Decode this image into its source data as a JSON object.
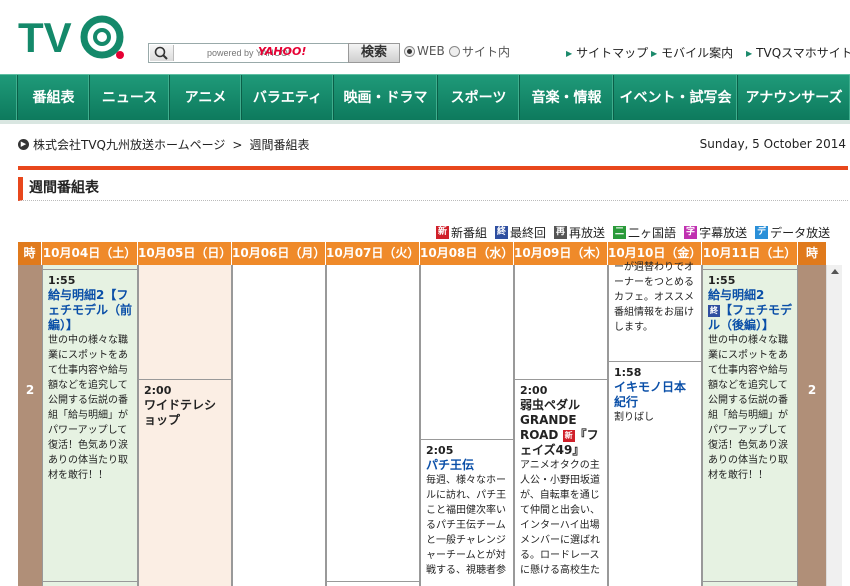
{
  "header": {
    "logo_text": "TVQ",
    "search": {
      "placeholder": "powered by YAHOO!",
      "yahoo_mark": "YAHOO!",
      "button_label": "検索"
    },
    "scope": [
      {
        "label": "WEB",
        "selected": true
      },
      {
        "label": "サイト内",
        "selected": false
      }
    ],
    "links": [
      "サイトマップ",
      "モバイル案内",
      "TVQスマホサイト"
    ]
  },
  "nav": {
    "items": [
      "番組表",
      "ニュース",
      "アニメ",
      "バラエティ",
      "映画・ドラマ",
      "スポーツ",
      "音楽・情報",
      "イベント・試写会",
      "アナウンサーズ"
    ]
  },
  "breadcrumb": {
    "home": "株式会社TVQ九州放送ホームページ",
    "sep": ">",
    "current": "週間番組表"
  },
  "date": "Sunday, 5 October 2014",
  "section_title": "週間番組表",
  "legend": [
    {
      "mark": "新",
      "label": "新番組",
      "color": "#d0202a"
    },
    {
      "mark": "終",
      "label": "最終回",
      "color": "#2f4fa0"
    },
    {
      "mark": "再",
      "label": "再放送",
      "color": "#555555"
    },
    {
      "mark": "二",
      "label": "二ヶ国語",
      "color": "#2a9a3a"
    },
    {
      "mark": "字",
      "label": "字幕放送",
      "color": "#c030b0"
    },
    {
      "mark": "デ",
      "label": "データ放送",
      "color": "#2a8fd8"
    }
  ],
  "schedule": {
    "time_header": "時",
    "hour": "2",
    "days": [
      "10月04日（土）",
      "10月05日（日）",
      "10月06日（月）",
      "10月07日（火）",
      "10月08日（水）",
      "10月09日（木）",
      "10月10日（金）",
      "10月11日（土）"
    ],
    "programs": {
      "sat1": {
        "time": "1:55",
        "title": "給与明細2【フェチモデル（前編）】",
        "desc": "世の中の様々な職業にスポットをあて仕事内容や給与額などを追究して公開する伝説の番組「給与明細」がパワーアップして復活！色気あり涙ありの体当たり取材を敢行！！"
      },
      "sun": {
        "time": "2:00",
        "title": "ワイドテレショップ"
      },
      "wed": {
        "time": "2:05",
        "title": "パチ王伝",
        "desc": "毎週、様々なホールに訪れ、パチ王こと福田健次率いるパチ王伝チームと一般チャレンジャーチームとが対戦する、視聴者参"
      },
      "thu": {
        "time": "2:00",
        "title1": "弱虫ペダル",
        "title2": "GRANDE ROAD",
        "badge": "新",
        "title3": "『フェイズ49』",
        "desc": "アニメオタクの主人公・小野田坂道が、自転車を通じて仲間と出会い、インターハイ出場メンバーに選ばれる。ロードレースに懸ける高校生た"
      },
      "fri_top": {
        "desc": "ーが週替わりでオーナーをつとめるカフェ。オススメ番組情報をお届けします。"
      },
      "fri": {
        "time": "1:58",
        "title": "イキモノ日本紀行",
        "desc": "割りばし"
      },
      "sat2": {
        "time": "1:55",
        "title": "給与明細2",
        "badge": "終",
        "title2": "【フェチモデル（後編）】",
        "desc": "世の中の様々な職業にスポットをあて仕事内容や給与額などを追究して公開する伝説の番組「給与明細」がパワーアップして復活！色気あり涙ありの体当たり取材を敢行！！"
      }
    }
  },
  "colors": {
    "nav_green": "#14896a",
    "accent_orange": "#ef8a2a",
    "accent_red": "#e8471c",
    "saturday_bg": "#e6f2e2",
    "sunday_bg": "#fbeee4",
    "time_col": "#b08f78"
  }
}
